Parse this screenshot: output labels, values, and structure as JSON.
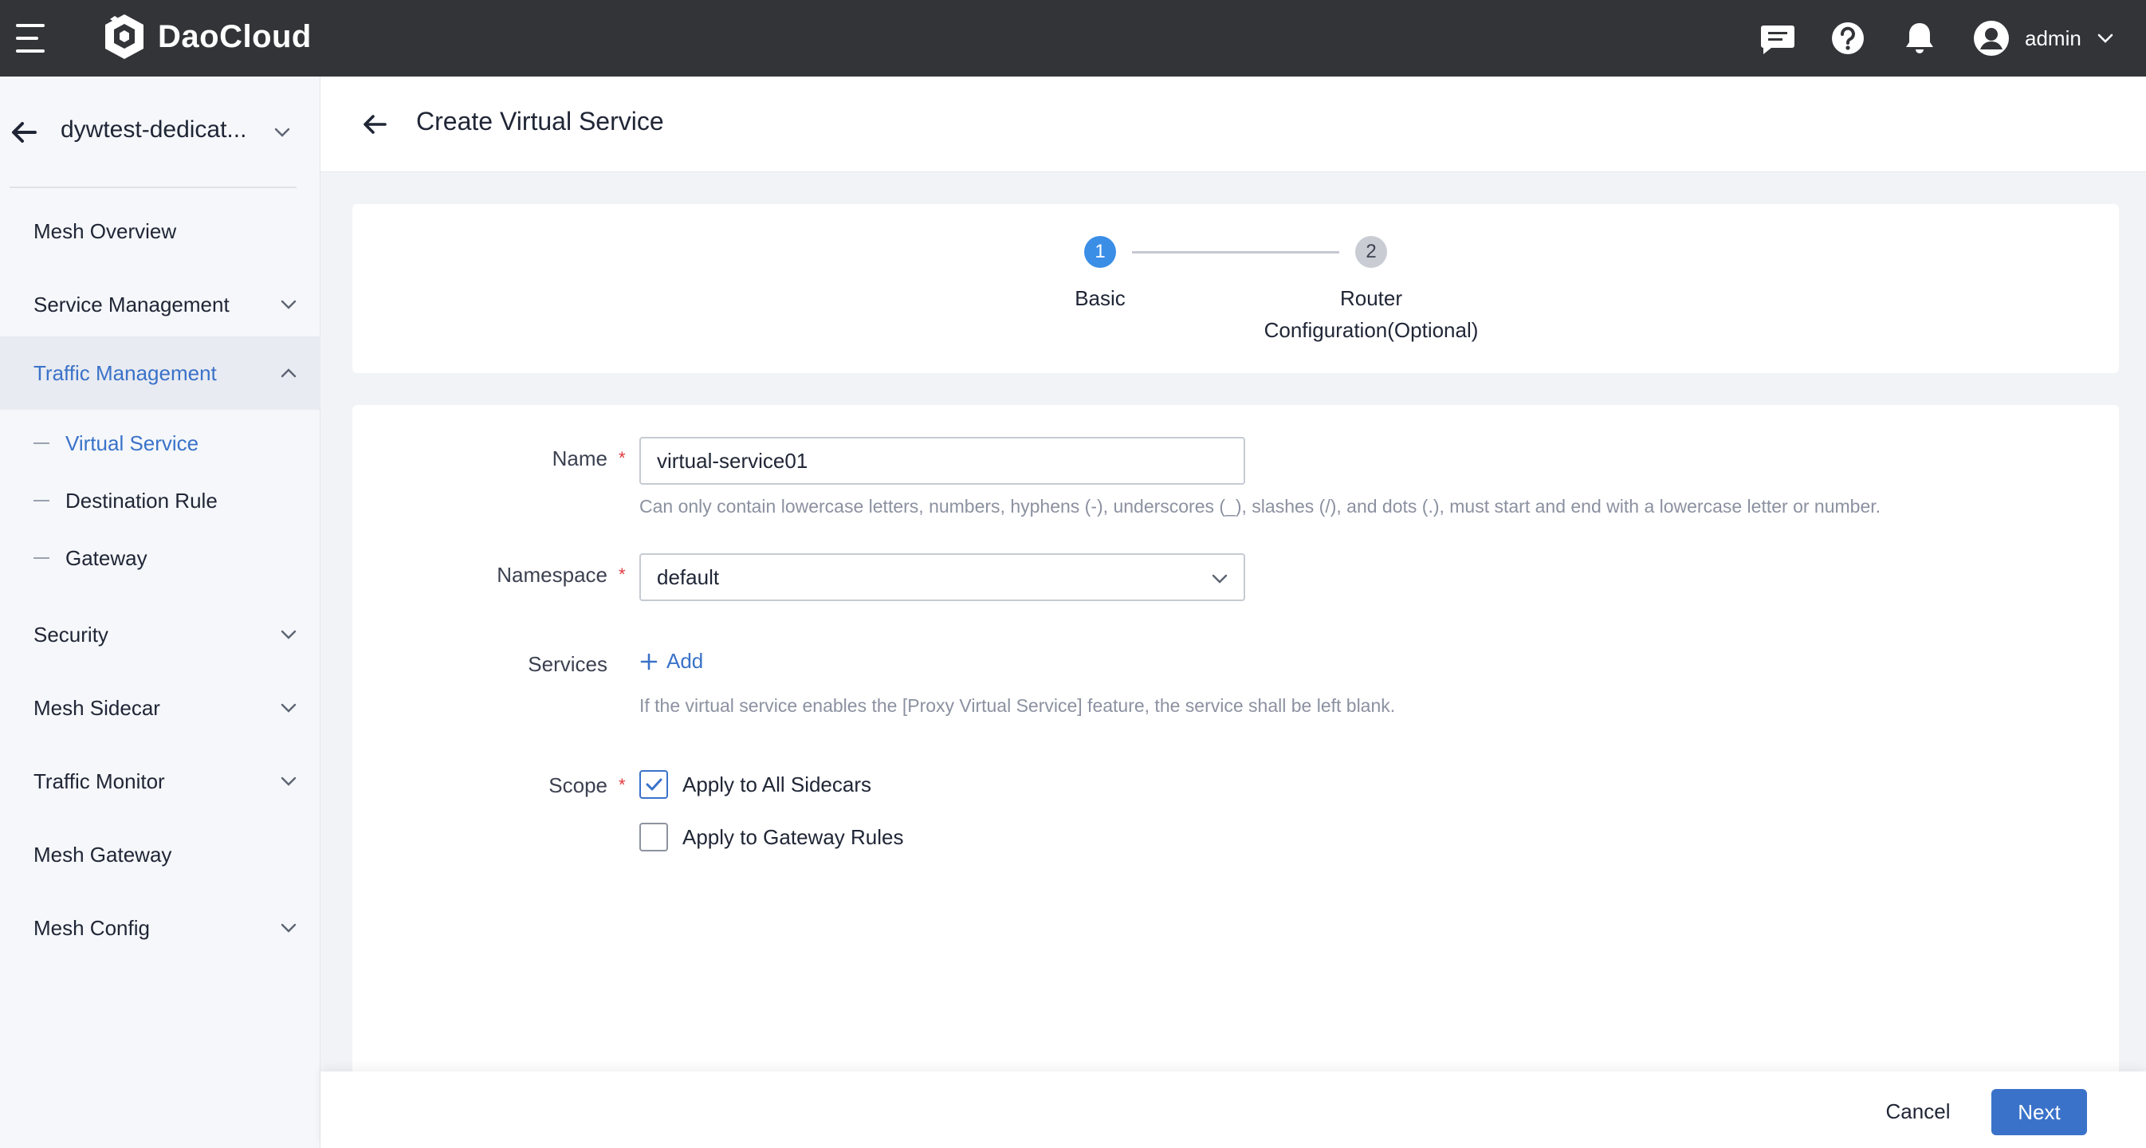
{
  "app": {
    "brand": "DaoCloud",
    "user": "admin",
    "icons": {
      "menu": "hamburger-icon",
      "messages": "message-icon",
      "help": "help-icon",
      "notifications": "bell-icon",
      "user": "user-avatar-icon"
    }
  },
  "sidebar": {
    "mesh_name": "dywtest-dedicat...",
    "items": [
      {
        "label": "Mesh Overview",
        "has_children": false
      },
      {
        "label": "Service Management",
        "has_children": true
      },
      {
        "label": "Traffic Management",
        "has_children": true,
        "expanded": true,
        "active": true
      },
      {
        "label": "Security",
        "has_children": true
      },
      {
        "label": "Mesh Sidecar",
        "has_children": true
      },
      {
        "label": "Traffic Monitor",
        "has_children": true
      },
      {
        "label": "Mesh Gateway",
        "has_children": false
      },
      {
        "label": "Mesh Config",
        "has_children": true
      }
    ],
    "sub_items": [
      {
        "label": "Virtual Service",
        "active": true
      },
      {
        "label": "Destination Rule",
        "active": false
      },
      {
        "label": "Gateway",
        "active": false
      }
    ]
  },
  "page": {
    "title": "Create Virtual Service"
  },
  "steps": [
    {
      "number": "1",
      "label": "Basic",
      "state": "active"
    },
    {
      "number": "2",
      "label": "Router Configuration(Optional)",
      "state": "pending"
    }
  ],
  "form": {
    "name": {
      "label": "Name",
      "value": "virtual-service01",
      "hint": "Can only contain lowercase letters, numbers, hyphens (-), underscores (_), slashes (/), and dots (.), must start and end with a lowercase letter or number."
    },
    "namespace": {
      "label": "Namespace",
      "value": "default"
    },
    "services": {
      "label": "Services",
      "add_label": "Add",
      "hint": "If the virtual service enables the [Proxy Virtual Service] feature, the service shall be left blank."
    },
    "scope": {
      "label": "Scope",
      "options": [
        {
          "label": "Apply to All Sidecars",
          "checked": true
        },
        {
          "label": "Apply to Gateway Rules",
          "checked": false
        }
      ]
    }
  },
  "footer": {
    "cancel_label": "Cancel",
    "next_label": "Next"
  },
  "colors": {
    "topbar": "#323438",
    "accent": "#3a72c9",
    "step_active": "#3a8ee6",
    "required": "#e0393e"
  }
}
